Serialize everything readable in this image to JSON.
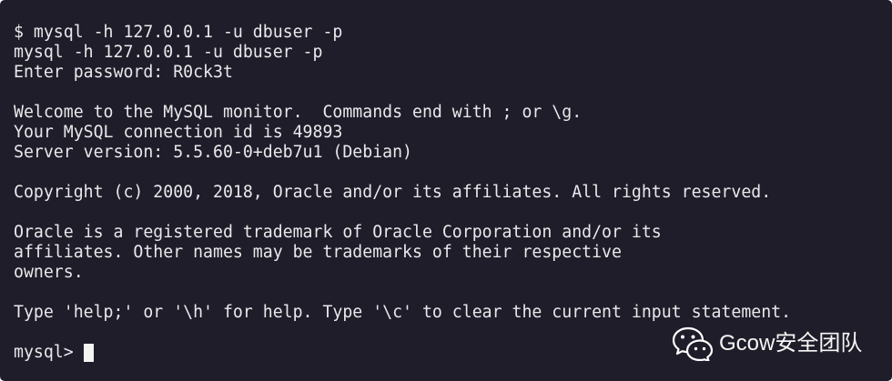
{
  "theme": {
    "background": "#1e1d29",
    "foreground": "#e9e9ec",
    "cursor": "#f4f4f4"
  },
  "terminal": {
    "lines": [
      "$ mysql -h 127.0.0.1 -u dbuser -p",
      "mysql -h 127.0.0.1 -u dbuser -p",
      "Enter password: R0ck3t",
      "",
      "Welcome to the MySQL monitor.  Commands end with ; or \\g.",
      "Your MySQL connection id is 49893",
      "Server version: 5.5.60-0+deb7u1 (Debian)",
      "",
      "Copyright (c) 2000, 2018, Oracle and/or its affiliates. All rights reserved.",
      "",
      "Oracle is a registered trademark of Oracle Corporation and/or its",
      "affiliates. Other names may be trademarks of their respective",
      "owners.",
      "",
      "Type 'help;' or '\\h' for help. Type '\\c' to clear the current input statement.",
      ""
    ],
    "prompt": "mysql>"
  },
  "watermark": {
    "icon": "wechat-icon",
    "text": "Gcow安全团队"
  }
}
